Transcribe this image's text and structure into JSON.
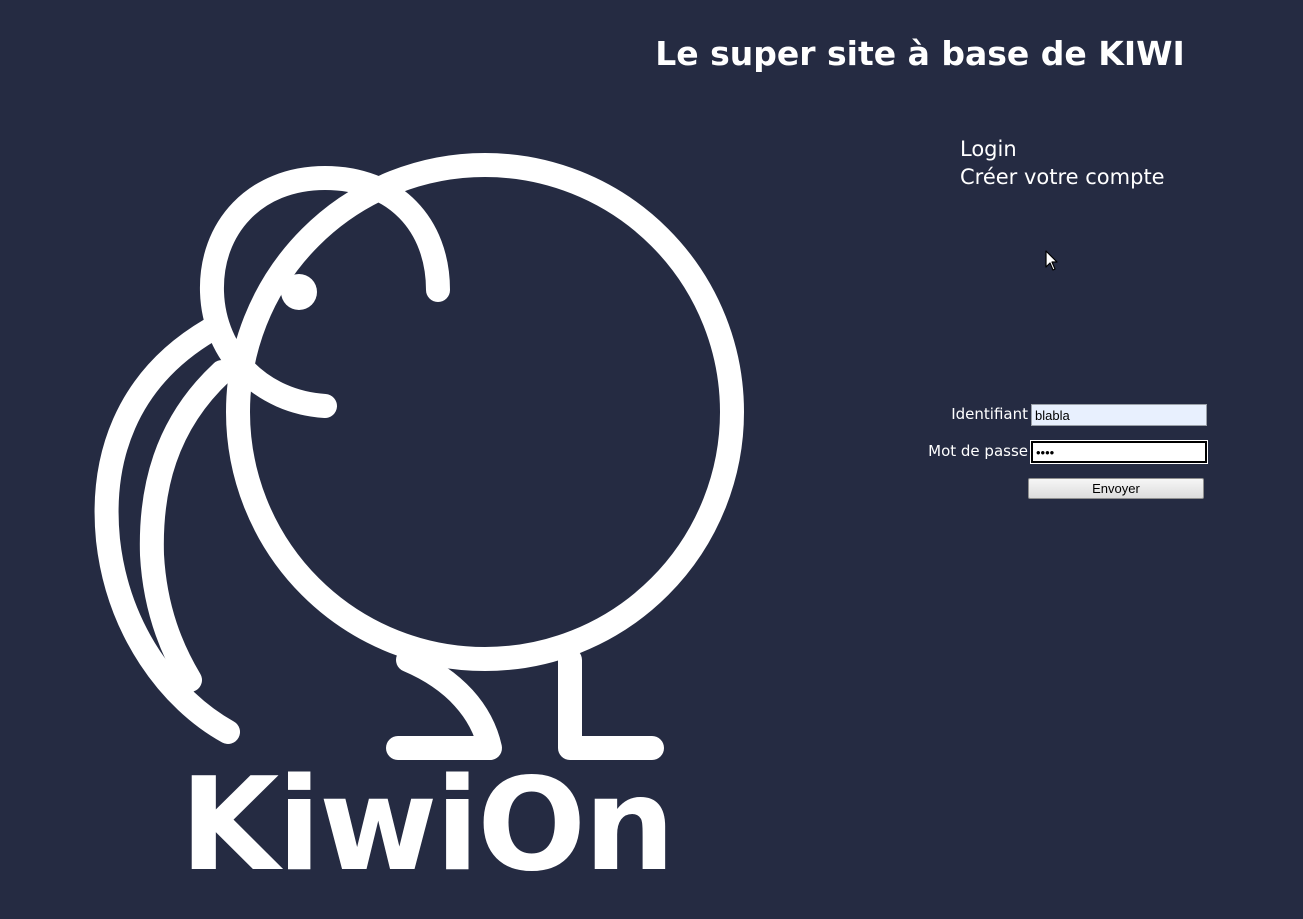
{
  "header": {
    "title": "Le super site à base de KIWI"
  },
  "nav": {
    "login": "Login",
    "create_account": "Créer votre compte"
  },
  "logo": {
    "icon": "kiwi-bird-icon",
    "brand_text": "KiwiOn",
    "color": "#ffffff"
  },
  "form": {
    "username_label": "Identifiant",
    "username_value": "blabla",
    "password_label": "Mot de passe",
    "password_value": "••••",
    "submit_label": "Envoyer"
  },
  "theme": {
    "background": "#252b42",
    "text": "#ffffff"
  }
}
